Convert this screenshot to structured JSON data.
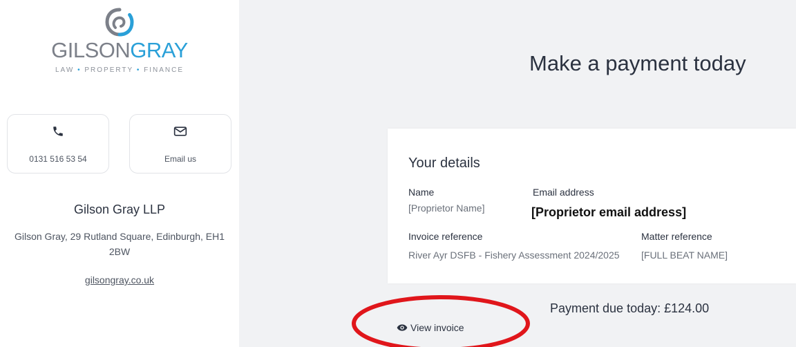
{
  "brand": {
    "name_part1": "GILSON",
    "name_part2": "GRAY",
    "tagline_words": [
      "LAW",
      "PROPERTY",
      "FINANCE"
    ],
    "tagline_separator": "•",
    "colors": {
      "gray": "#7c8089",
      "blue": "#2aa0d8"
    }
  },
  "contact": {
    "phone_label": "0131 516 53 54",
    "email_label": "Email us",
    "phone_icon": "phone-icon",
    "email_icon": "envelope-icon"
  },
  "firm": {
    "name": "Gilson Gray LLP",
    "address": "Gilson Gray, 29 Rutland Square, Edinburgh, EH1 2BW",
    "website": "gilsongray.co.uk"
  },
  "page": {
    "title": "Make a payment today"
  },
  "details": {
    "title": "Your details",
    "name_label": "Name",
    "name_value": "[Proprietor Name]",
    "email_label": "Email address",
    "email_value": "[Proprietor email address]",
    "invoice_ref_label": "Invoice reference",
    "invoice_ref_value": "River Ayr DSFB - Fishery Assessment 2024/2025",
    "matter_ref_label": "Matter reference",
    "matter_ref_value": "[FULL BEAT NAME]"
  },
  "payment": {
    "due_text": "Payment due today: £124.00",
    "view_invoice_label": "View invoice",
    "view_invoice_icon": "eye-icon",
    "highlight_color": "#e0161b"
  }
}
